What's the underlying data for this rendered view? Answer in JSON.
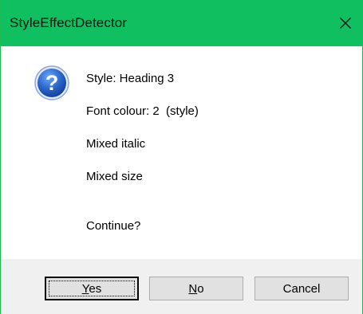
{
  "dialog": {
    "title": "StyleEffectDetector",
    "close_icon": "close-icon",
    "icon": "question-icon",
    "messages": [
      "Style: Heading 3",
      "Font colour: 2  (style)",
      "Mixed italic",
      "Mixed size",
      "Continue?"
    ],
    "buttons": {
      "yes": {
        "mnemonic": "Y",
        "rest": "es"
      },
      "no": {
        "mnemonic": "N",
        "rest": "o"
      },
      "cancel": {
        "label": "Cancel"
      }
    },
    "colors": {
      "titlebar": "#10c060",
      "icon": "#1f5fbf"
    }
  }
}
